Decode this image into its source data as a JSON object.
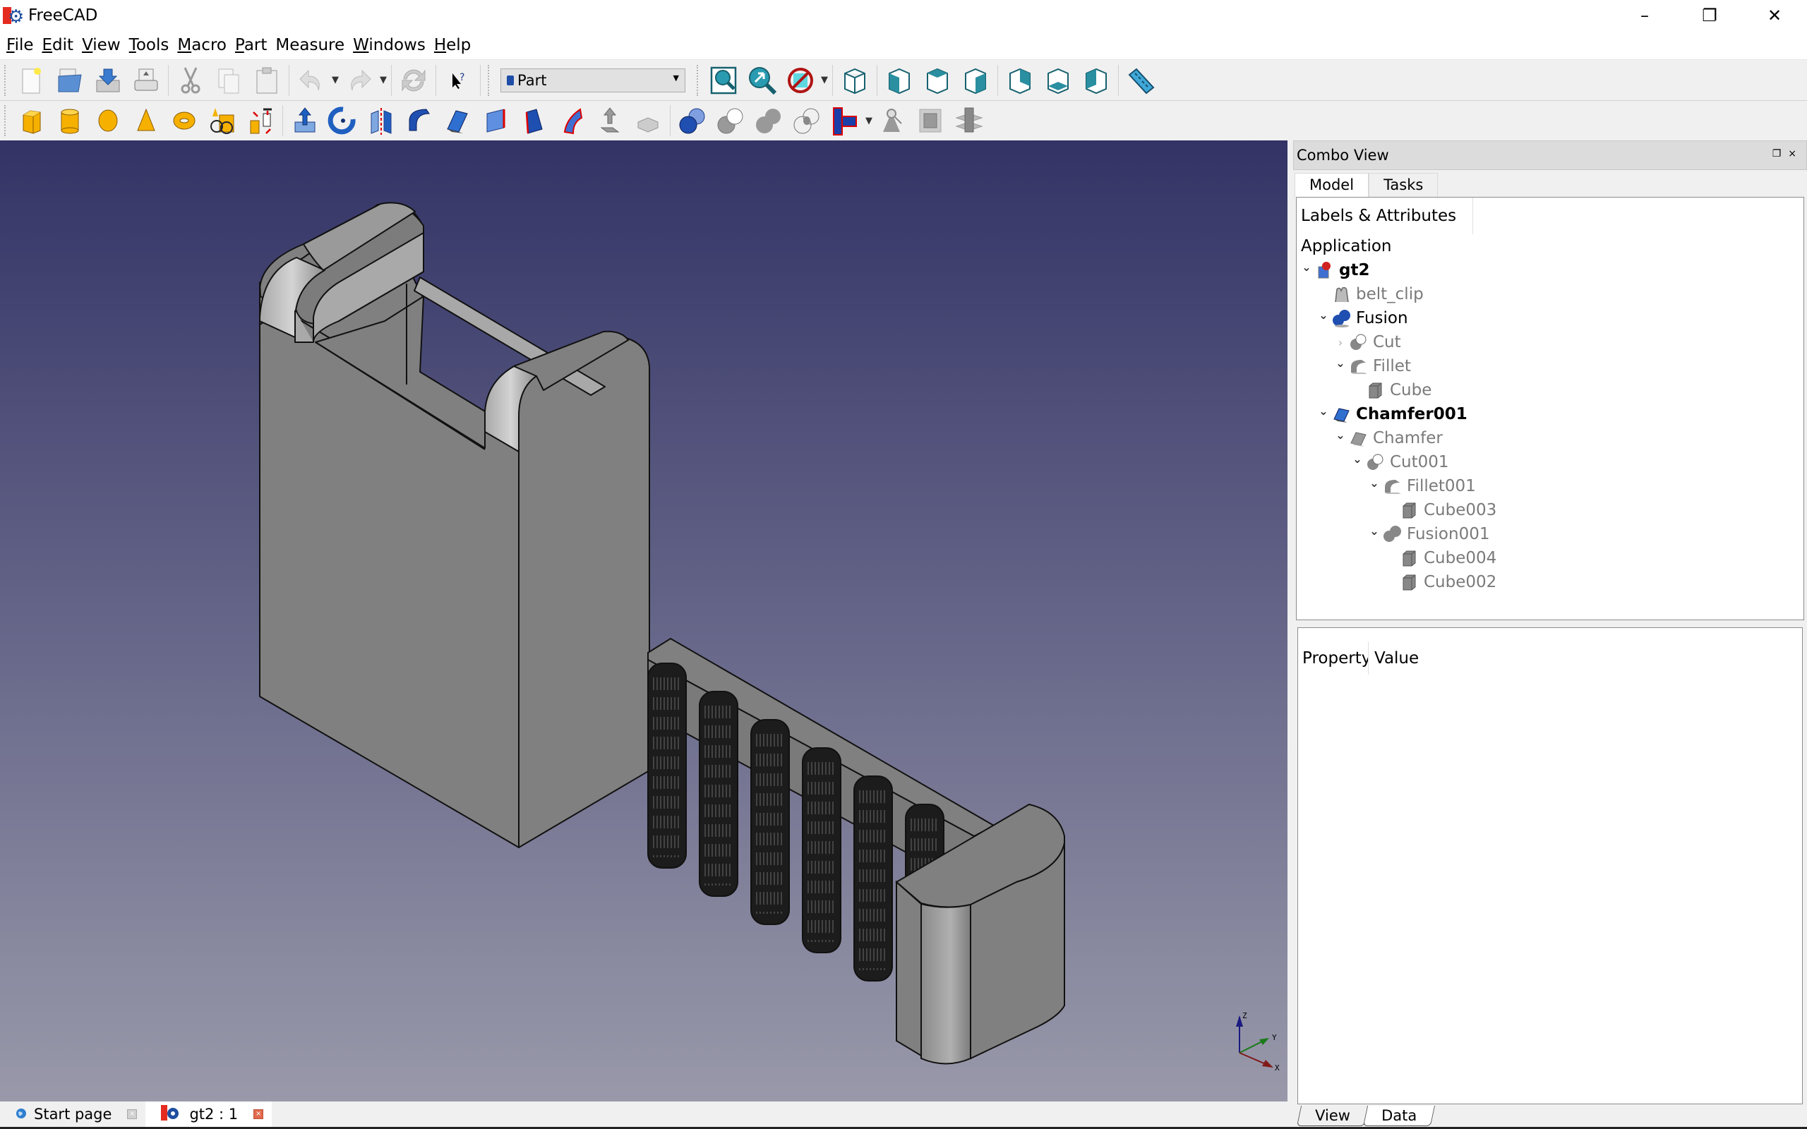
{
  "window": {
    "title": "FreeCAD",
    "controls": {
      "minimize": "–",
      "restore": "❐",
      "close": "✕"
    }
  },
  "menubar": [
    {
      "label": "File",
      "mnemonic": "F"
    },
    {
      "label": "Edit",
      "mnemonic": "E"
    },
    {
      "label": "View",
      "mnemonic": "V"
    },
    {
      "label": "Tools",
      "mnemonic": "T"
    },
    {
      "label": "Macro",
      "mnemonic": "M"
    },
    {
      "label": "Part",
      "mnemonic": "P"
    },
    {
      "label": "Measure",
      "mnemonic": ""
    },
    {
      "label": "Windows",
      "mnemonic": "W"
    },
    {
      "label": "Help",
      "mnemonic": "H"
    }
  ],
  "toolbar1": {
    "file_icons": [
      "new-document-icon",
      "open-folder-icon",
      "save-icon",
      "print-icon"
    ],
    "edit_icons": [
      "cut-icon",
      "copy-icon",
      "paste-icon"
    ],
    "history_icons": [
      "undo-icon",
      "redo-icon"
    ],
    "refresh_icon": "refresh-icon",
    "whats_this_icon": "whats-this-icon",
    "workbench": {
      "selected": "Part"
    },
    "view_icons": [
      "fit-all-icon",
      "fit-selection-icon",
      "draw-style-icon"
    ],
    "std_views": [
      "isometric-view-icon",
      "front-view-icon",
      "top-view-icon",
      "right-view-icon",
      "rear-view-icon",
      "bottom-view-icon",
      "left-view-icon"
    ],
    "measure_icon": "measure-ruler-icon"
  },
  "toolbar2": {
    "primitives": [
      "box-icon",
      "cylinder-icon",
      "sphere-icon",
      "cone-icon",
      "torus-icon",
      "create-primitives-icon",
      "shape-builder-icon"
    ],
    "tools": [
      "extrude-icon",
      "revolve-icon",
      "mirror-icon",
      "fillet-icon",
      "chamfer-icon",
      "make-face-icon",
      "ruled-surface-icon",
      "loft-icon",
      "sweep-icon",
      "section-icon",
      "cross-sections-icon"
    ],
    "booleans": [
      "boolean-icon",
      "cut-icon",
      "fuse-icon",
      "common-icon",
      "join-features-icon",
      "check-geometry-icon",
      "offset-icon",
      "thickness-icon"
    ]
  },
  "viewport": {
    "background_top": "#333366",
    "background_bottom": "#9999aa",
    "axis_labels": {
      "x": "X",
      "y": "Y",
      "z": "Z"
    }
  },
  "combo_view": {
    "title": "Combo View",
    "tabs": [
      {
        "label": "Model",
        "active": true
      },
      {
        "label": "Tasks",
        "active": false
      }
    ],
    "tree_header": "Labels & Attributes",
    "tree": [
      {
        "label": "Application",
        "level": 0,
        "expander": "",
        "icon": "",
        "style": "normal"
      },
      {
        "label": "gt2",
        "level": 0,
        "expander": "expanded",
        "icon": "document-icon",
        "style": "bold"
      },
      {
        "label": "belt_clip",
        "level": 1,
        "expander": "",
        "icon": "sketch-icon",
        "style": "grey"
      },
      {
        "label": "Fusion",
        "level": 1,
        "expander": "expanded",
        "icon": "fusion-blue-icon",
        "style": "normal"
      },
      {
        "label": "Cut",
        "level": 2,
        "expander": "collapsed",
        "icon": "cut-grey-icon",
        "style": "grey"
      },
      {
        "label": "Fillet",
        "level": 2,
        "expander": "expanded",
        "icon": "fillet-grey-icon",
        "style": "grey"
      },
      {
        "label": "Cube",
        "level": 3,
        "expander": "",
        "icon": "cube-grey-icon",
        "style": "grey"
      },
      {
        "label": "Chamfer001",
        "level": 1,
        "expander": "expanded",
        "icon": "chamfer-blue-icon",
        "style": "bold"
      },
      {
        "label": "Chamfer",
        "level": 2,
        "expander": "expanded",
        "icon": "chamfer-grey-icon",
        "style": "grey"
      },
      {
        "label": "Cut001",
        "level": 3,
        "expander": "expanded",
        "icon": "cut-grey-icon",
        "style": "grey"
      },
      {
        "label": "Fillet001",
        "level": 4,
        "expander": "expanded",
        "icon": "fillet-grey-icon",
        "style": "grey"
      },
      {
        "label": "Cube003",
        "level": 5,
        "expander": "",
        "icon": "cube-grey-icon",
        "style": "grey"
      },
      {
        "label": "Fusion001",
        "level": 4,
        "expander": "expanded",
        "icon": "fusion-grey-icon",
        "style": "grey"
      },
      {
        "label": "Cube004",
        "level": 5,
        "expander": "",
        "icon": "cube-grey-icon",
        "style": "grey"
      },
      {
        "label": "Cube002",
        "level": 5,
        "expander": "",
        "icon": "cube-grey-icon",
        "style": "grey"
      }
    ],
    "property_headers": {
      "property": "Property",
      "value": "Value"
    },
    "property_tabs": [
      {
        "label": "View",
        "active": false
      },
      {
        "label": "Data",
        "active": true
      }
    ]
  },
  "document_tabs": [
    {
      "label": "Start page",
      "icon": "globe-icon",
      "active": false
    },
    {
      "label": "gt2 : 1",
      "icon": "freecad-icon",
      "active": true
    }
  ]
}
